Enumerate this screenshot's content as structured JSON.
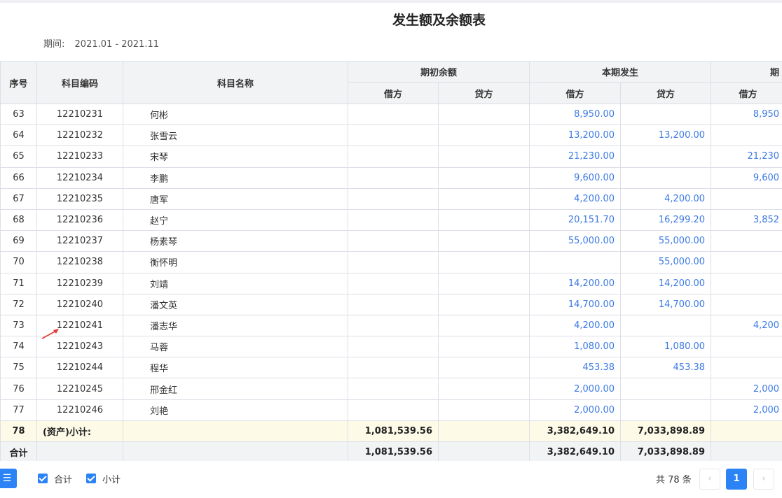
{
  "report": {
    "title": "发生额及余额表",
    "period_label": "期间:",
    "period_value": "2021.01 - 2021.11"
  },
  "columns": {
    "seq": "序号",
    "code": "科目编码",
    "name": "科目名称",
    "opening": "期初余额",
    "current": "本期发生",
    "closing_partial": "期",
    "debit": "借方",
    "credit": "贷方"
  },
  "rows": [
    {
      "seq": "63",
      "code": "12210231",
      "name": "何彬",
      "cur_debit": "8,950.00",
      "cur_credit": "",
      "end_debit": "8,950"
    },
    {
      "seq": "64",
      "code": "12210232",
      "name": "张雪云",
      "cur_debit": "13,200.00",
      "cur_credit": "13,200.00",
      "end_debit": ""
    },
    {
      "seq": "65",
      "code": "12210233",
      "name": "宋琴",
      "cur_debit": "21,230.00",
      "cur_credit": "",
      "end_debit": "21,230"
    },
    {
      "seq": "66",
      "code": "12210234",
      "name": "李鹏",
      "cur_debit": "9,600.00",
      "cur_credit": "",
      "end_debit": "9,600"
    },
    {
      "seq": "67",
      "code": "12210235",
      "name": "唐军",
      "cur_debit": "4,200.00",
      "cur_credit": "4,200.00",
      "end_debit": ""
    },
    {
      "seq": "68",
      "code": "12210236",
      "name": "赵宁",
      "cur_debit": "20,151.70",
      "cur_credit": "16,299.20",
      "end_debit": "3,852"
    },
    {
      "seq": "69",
      "code": "12210237",
      "name": "杨素琴",
      "cur_debit": "55,000.00",
      "cur_credit": "55,000.00",
      "end_debit": ""
    },
    {
      "seq": "70",
      "code": "12210238",
      "name": "衡怀明",
      "cur_debit": "",
      "cur_credit": "55,000.00",
      "end_debit": ""
    },
    {
      "seq": "71",
      "code": "12210239",
      "name": "刘靖",
      "cur_debit": "14,200.00",
      "cur_credit": "14,200.00",
      "end_debit": ""
    },
    {
      "seq": "72",
      "code": "12210240",
      "name": "潘文英",
      "cur_debit": "14,700.00",
      "cur_credit": "14,700.00",
      "end_debit": ""
    },
    {
      "seq": "73",
      "code": "12210241",
      "name": "潘志华",
      "cur_debit": "4,200.00",
      "cur_credit": "",
      "end_debit": "4,200"
    },
    {
      "seq": "74",
      "code": "12210243",
      "name": "马蓉",
      "cur_debit": "1,080.00",
      "cur_credit": "1,080.00",
      "end_debit": ""
    },
    {
      "seq": "75",
      "code": "12210244",
      "name": "程华",
      "cur_debit": "453.38",
      "cur_credit": "453.38",
      "end_debit": ""
    },
    {
      "seq": "76",
      "code": "12210245",
      "name": "邢金红",
      "cur_debit": "2,000.00",
      "cur_credit": "",
      "end_debit": "2,000"
    },
    {
      "seq": "77",
      "code": "12210246",
      "name": "刘艳",
      "cur_debit": "2,000.00",
      "cur_credit": "",
      "end_debit": "2,000"
    }
  ],
  "subtotal": {
    "seq": "78",
    "label": "(资产)小计:",
    "open_debit": "1,081,539.56",
    "cur_debit": "3,382,649.10",
    "cur_credit": "7,033,898.89"
  },
  "total": {
    "label": "合计",
    "open_debit": "1,081,539.56",
    "cur_debit": "3,382,649.10",
    "cur_credit": "7,033,898.89"
  },
  "footer": {
    "menu_icon_glyph": "☰",
    "checkbox_total_label": "合计",
    "checkbox_subtotal_label": "小计",
    "total_count": "共 78 条",
    "prev_glyph": "‹",
    "current_page": "1",
    "next_glyph": "›"
  },
  "colors": {
    "accent": "#2b83f6",
    "amount_blue": "#3c7ae4",
    "header_bg": "#f2f3f5",
    "subtotal_bg": "#fdfbe8",
    "annotation_arrow": "#e53935"
  }
}
